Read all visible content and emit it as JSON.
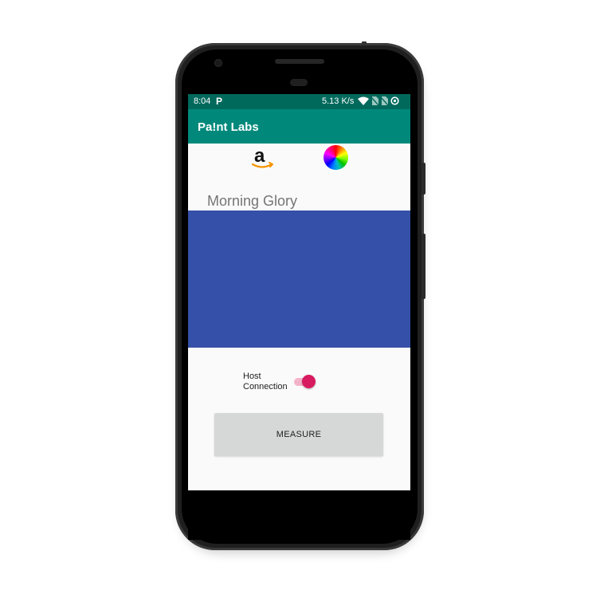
{
  "status_bar": {
    "time": "8:04",
    "notification": "P",
    "network_speed": "5.13 K/s"
  },
  "app_bar": {
    "title": "Pa!nt Labs"
  },
  "toolbar_icons": {
    "amazon": "amazon-logo-icon",
    "color_wheel": "color-wheel-icon"
  },
  "color": {
    "name": "Morning Glory",
    "swatch_hex": "#3550a8"
  },
  "host_connection": {
    "label": "Host Connection",
    "enabled": true
  },
  "measure_button": {
    "label": "MEASURE"
  },
  "colors": {
    "status_bar": "#00695c",
    "app_bar": "#00897b",
    "accent": "#d81b60"
  }
}
